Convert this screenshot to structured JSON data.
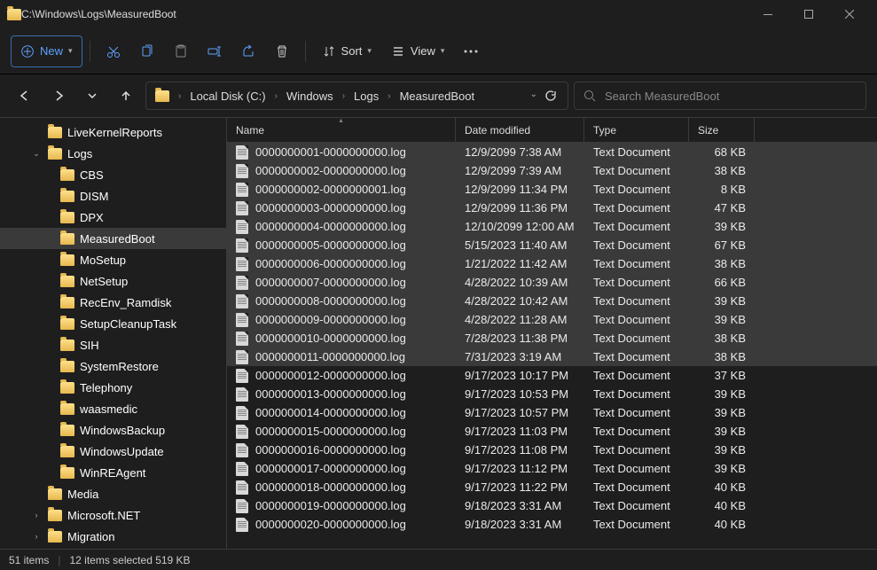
{
  "window": {
    "title_path": "C:\\Windows\\Logs\\MeasuredBoot"
  },
  "toolbar": {
    "new_label": "New",
    "sort_label": "Sort",
    "view_label": "View"
  },
  "breadcrumb": {
    "segments": [
      "Local Disk (C:)",
      "Windows",
      "Logs",
      "MeasuredBoot"
    ]
  },
  "search": {
    "placeholder": "Search MeasuredBoot"
  },
  "tree": {
    "items": [
      {
        "label": "LiveKernelReports",
        "indent": 2,
        "exp": "",
        "sel": false
      },
      {
        "label": "Logs",
        "indent": 2,
        "exp": "v",
        "sel": false
      },
      {
        "label": "CBS",
        "indent": 3,
        "exp": "",
        "sel": false
      },
      {
        "label": "DISM",
        "indent": 3,
        "exp": "",
        "sel": false
      },
      {
        "label": "DPX",
        "indent": 3,
        "exp": "",
        "sel": false
      },
      {
        "label": "MeasuredBoot",
        "indent": 3,
        "exp": "",
        "sel": true
      },
      {
        "label": "MoSetup",
        "indent": 3,
        "exp": "",
        "sel": false
      },
      {
        "label": "NetSetup",
        "indent": 3,
        "exp": "",
        "sel": false
      },
      {
        "label": "RecEnv_Ramdisk",
        "indent": 3,
        "exp": "",
        "sel": false
      },
      {
        "label": "SetupCleanupTask",
        "indent": 3,
        "exp": "",
        "sel": false
      },
      {
        "label": "SIH",
        "indent": 3,
        "exp": "",
        "sel": false
      },
      {
        "label": "SystemRestore",
        "indent": 3,
        "exp": "",
        "sel": false
      },
      {
        "label": "Telephony",
        "indent": 3,
        "exp": "",
        "sel": false
      },
      {
        "label": "waasmedic",
        "indent": 3,
        "exp": "",
        "sel": false
      },
      {
        "label": "WindowsBackup",
        "indent": 3,
        "exp": "",
        "sel": false
      },
      {
        "label": "WindowsUpdate",
        "indent": 3,
        "exp": "",
        "sel": false
      },
      {
        "label": "WinREAgent",
        "indent": 3,
        "exp": "",
        "sel": false
      },
      {
        "label": "Media",
        "indent": 2,
        "exp": "",
        "sel": false
      },
      {
        "label": "Microsoft.NET",
        "indent": 2,
        "exp": ">",
        "sel": false
      },
      {
        "label": "Migration",
        "indent": 2,
        "exp": ">",
        "sel": false
      }
    ]
  },
  "columns": {
    "name": "Name",
    "date": "Date modified",
    "type": "Type",
    "size": "Size"
  },
  "files": [
    {
      "name": "0000000001-0000000000.log",
      "date": "12/9/2099 7:38 AM",
      "type": "Text Document",
      "size": "68 KB",
      "sel": true
    },
    {
      "name": "0000000002-0000000000.log",
      "date": "12/9/2099 7:39 AM",
      "type": "Text Document",
      "size": "38 KB",
      "sel": true
    },
    {
      "name": "0000000002-0000000001.log",
      "date": "12/9/2099 11:34 PM",
      "type": "Text Document",
      "size": "8 KB",
      "sel": true
    },
    {
      "name": "0000000003-0000000000.log",
      "date": "12/9/2099 11:36 PM",
      "type": "Text Document",
      "size": "47 KB",
      "sel": true
    },
    {
      "name": "0000000004-0000000000.log",
      "date": "12/10/2099 12:00 AM",
      "type": "Text Document",
      "size": "39 KB",
      "sel": true
    },
    {
      "name": "0000000005-0000000000.log",
      "date": "5/15/2023 11:40 AM",
      "type": "Text Document",
      "size": "67 KB",
      "sel": true
    },
    {
      "name": "0000000006-0000000000.log",
      "date": "1/21/2022 11:42 AM",
      "type": "Text Document",
      "size": "38 KB",
      "sel": true
    },
    {
      "name": "0000000007-0000000000.log",
      "date": "4/28/2022 10:39 AM",
      "type": "Text Document",
      "size": "66 KB",
      "sel": true
    },
    {
      "name": "0000000008-0000000000.log",
      "date": "4/28/2022 10:42 AM",
      "type": "Text Document",
      "size": "39 KB",
      "sel": true
    },
    {
      "name": "0000000009-0000000000.log",
      "date": "4/28/2022 11:28 AM",
      "type": "Text Document",
      "size": "39 KB",
      "sel": true
    },
    {
      "name": "0000000010-0000000000.log",
      "date": "7/28/2023 11:38 PM",
      "type": "Text Document",
      "size": "38 KB",
      "sel": true
    },
    {
      "name": "0000000011-0000000000.log",
      "date": "7/31/2023 3:19 AM",
      "type": "Text Document",
      "size": "38 KB",
      "sel": true
    },
    {
      "name": "0000000012-0000000000.log",
      "date": "9/17/2023 10:17 PM",
      "type": "Text Document",
      "size": "37 KB",
      "sel": false
    },
    {
      "name": "0000000013-0000000000.log",
      "date": "9/17/2023 10:53 PM",
      "type": "Text Document",
      "size": "39 KB",
      "sel": false
    },
    {
      "name": "0000000014-0000000000.log",
      "date": "9/17/2023 10:57 PM",
      "type": "Text Document",
      "size": "39 KB",
      "sel": false
    },
    {
      "name": "0000000015-0000000000.log",
      "date": "9/17/2023 11:03 PM",
      "type": "Text Document",
      "size": "39 KB",
      "sel": false
    },
    {
      "name": "0000000016-0000000000.log",
      "date": "9/17/2023 11:08 PM",
      "type": "Text Document",
      "size": "39 KB",
      "sel": false
    },
    {
      "name": "0000000017-0000000000.log",
      "date": "9/17/2023 11:12 PM",
      "type": "Text Document",
      "size": "39 KB",
      "sel": false
    },
    {
      "name": "0000000018-0000000000.log",
      "date": "9/17/2023 11:22 PM",
      "type": "Text Document",
      "size": "40 KB",
      "sel": false
    },
    {
      "name": "0000000019-0000000000.log",
      "date": "9/18/2023 3:31 AM",
      "type": "Text Document",
      "size": "40 KB",
      "sel": false
    },
    {
      "name": "0000000020-0000000000.log",
      "date": "9/18/2023 3:31 AM",
      "type": "Text Document",
      "size": "40 KB",
      "sel": false
    }
  ],
  "status": {
    "total": "51 items",
    "selected": "12 items selected  519 KB"
  }
}
